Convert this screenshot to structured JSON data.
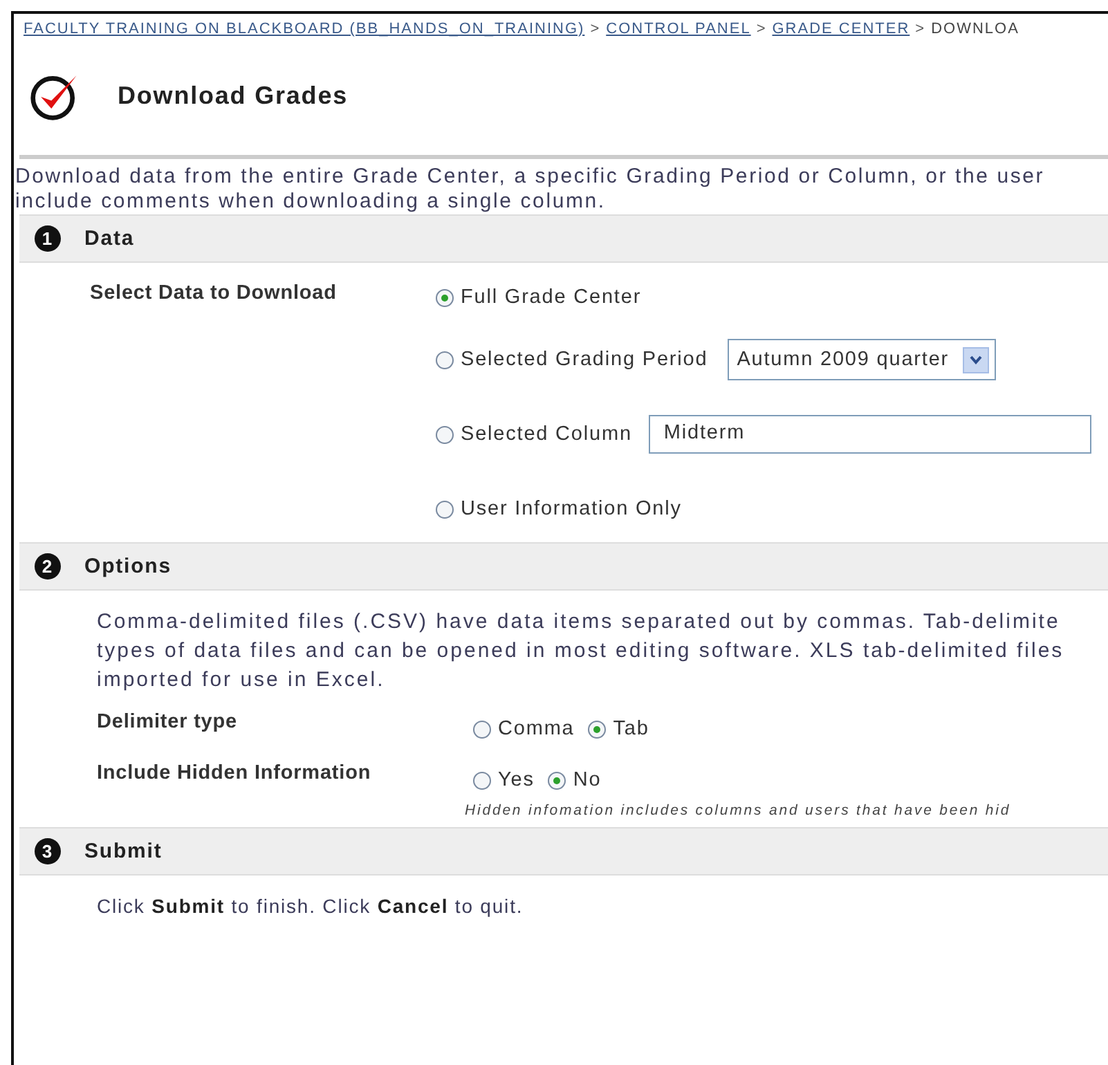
{
  "breadcrumb": [
    {
      "label": "FACULTY TRAINING ON BLACKBOARD (BB_HANDS_ON_TRAINING)",
      "link": true
    },
    {
      "label": "CONTROL PANEL",
      "link": true
    },
    {
      "label": "GRADE CENTER",
      "link": true
    },
    {
      "label": "DOWNLOA",
      "link": false
    }
  ],
  "breadcrumb_separator": ">",
  "title": "Download Grades",
  "description": [
    "Download data from the entire Grade Center, a specific Grading Period or Column, or the user",
    "include comments when downloading a single column."
  ],
  "sections": [
    {
      "number": "1",
      "title": "Data",
      "kind": "data",
      "label": "Select Data to Download",
      "options": [
        {
          "label": "Full Grade Center",
          "selected": true,
          "kind": "plain"
        },
        {
          "label": "Selected Grading Period",
          "selected": false,
          "kind": "select",
          "value": "Autumn 2009 quarter"
        },
        {
          "label": "Selected Column",
          "selected": false,
          "kind": "input",
          "value": "Midterm"
        },
        {
          "label": "User Information Only",
          "selected": false,
          "kind": "plain"
        }
      ]
    },
    {
      "number": "2",
      "title": "Options",
      "kind": "options",
      "text": [
        "Comma-delimited files (.CSV) have data items separated out by commas. Tab-delimite",
        "types of data files and can be opened in most editing software. XLS tab-delimited files",
        "imported for use in Excel."
      ],
      "fields": [
        {
          "label": "Delimiter type",
          "options": [
            {
              "label": "Comma",
              "selected": false
            },
            {
              "label": "Tab",
              "selected": true
            }
          ]
        },
        {
          "label": "Include Hidden Information",
          "options": [
            {
              "label": "Yes",
              "selected": false
            },
            {
              "label": "No",
              "selected": true
            }
          ],
          "note": "Hidden infomation includes columns and users that have been hid"
        }
      ]
    },
    {
      "number": "3",
      "title": "Submit",
      "kind": "submit",
      "text": "Click **Submit** to finish. Click **Cancel** to quit."
    }
  ]
}
